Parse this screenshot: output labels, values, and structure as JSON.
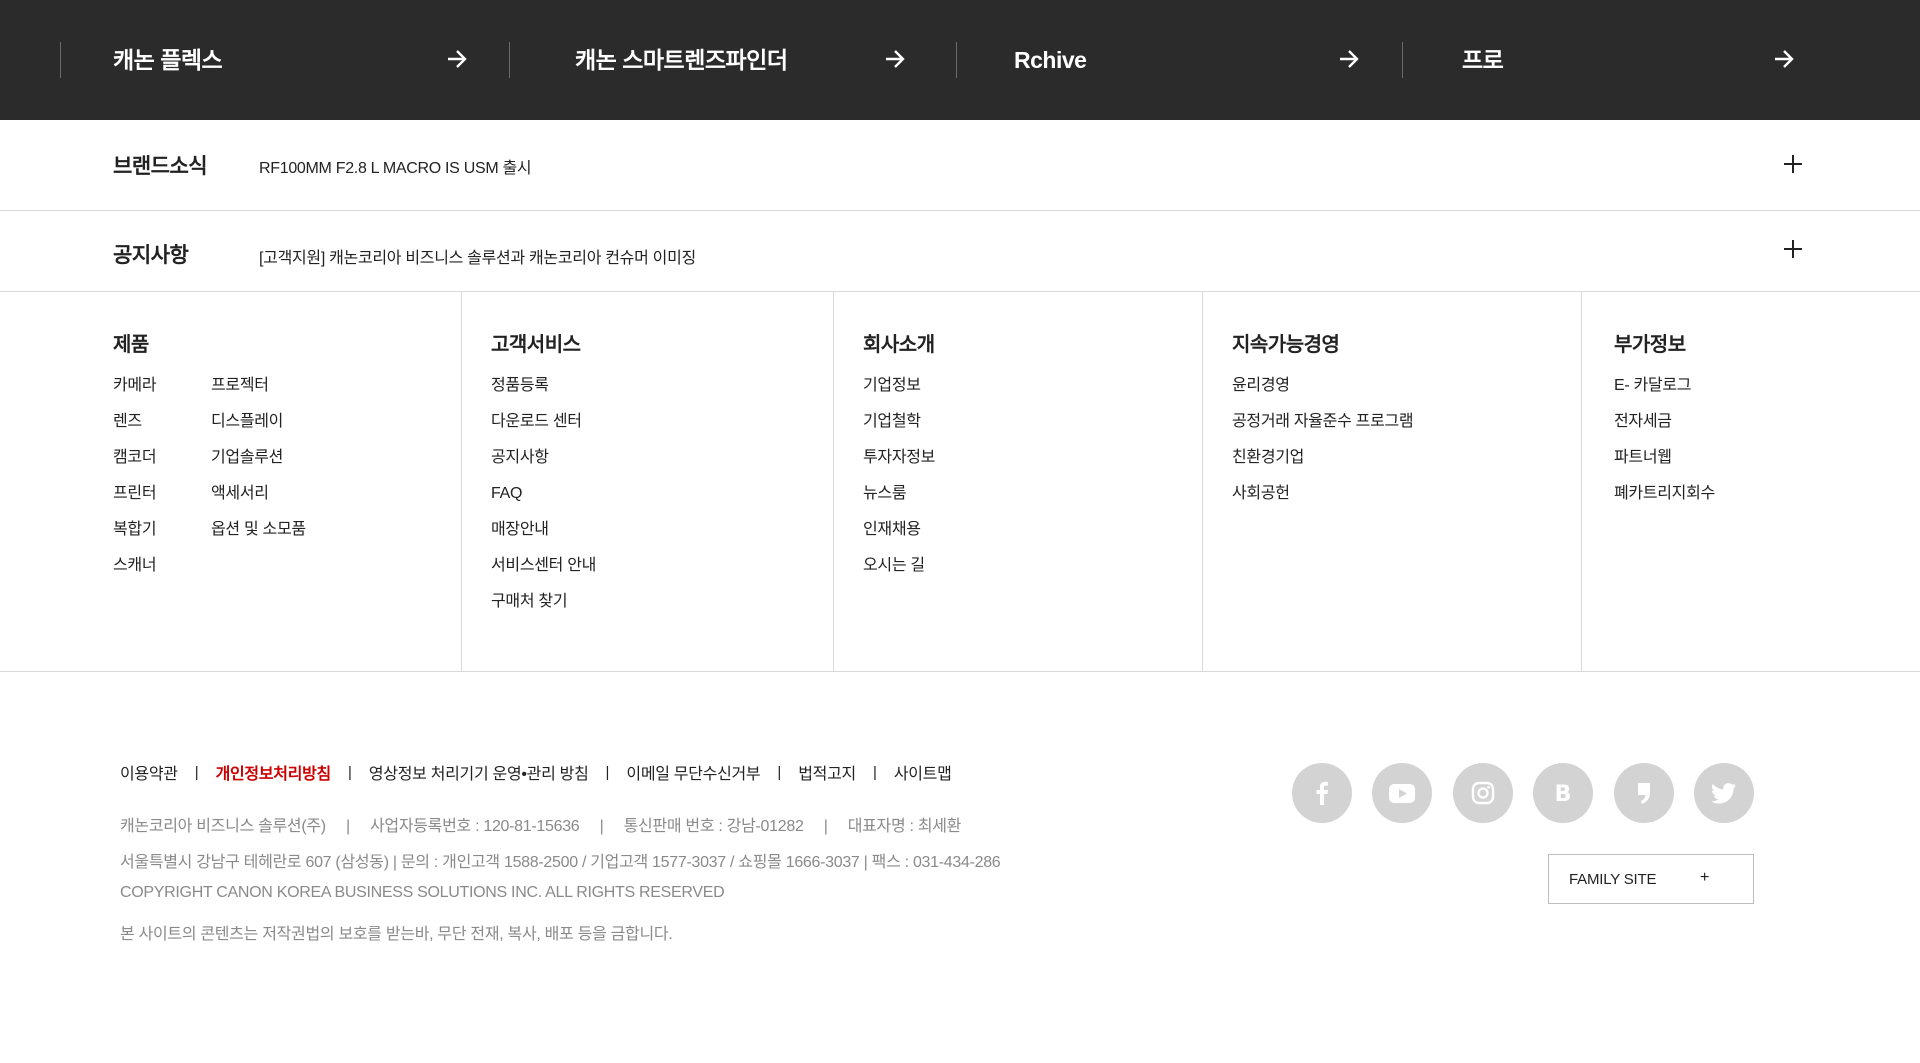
{
  "topbar": {
    "items": [
      {
        "label": "캐논 플렉스"
      },
      {
        "label": "캐논 스마트렌즈파인더"
      },
      {
        "label": "Rchive"
      },
      {
        "label": "프로"
      }
    ]
  },
  "news": {
    "brand": {
      "title": "브랜드소식",
      "text": "RF100MM F2.8 L MACRO IS USM 출시"
    },
    "notice": {
      "title": "공지사항",
      "text": "[고객지원] 캐논코리아 비즈니스 솔루션과 캐논코리아 컨슈머 이미징"
    }
  },
  "sitemap": {
    "products": {
      "title": "제품",
      "col1": [
        "카메라",
        "렌즈",
        "캠코더",
        "프린터",
        "복합기",
        "스캐너"
      ],
      "col2": [
        "프로젝터",
        "디스플레이",
        "기업솔루션",
        "액세서리",
        "옵션 및 소모품"
      ]
    },
    "support": {
      "title": "고객서비스",
      "items": [
        "정품등록",
        "다운로드 센터",
        "공지사항",
        "FAQ",
        "매장안내",
        "서비스센터 안내",
        "구매처 찾기"
      ]
    },
    "company": {
      "title": "회사소개",
      "items": [
        "기업정보",
        "기업철학",
        "투자자정보",
        "뉴스룸",
        "인재채용",
        "오시는 길"
      ]
    },
    "sustainability": {
      "title": "지속가능경영",
      "items": [
        "윤리경영",
        "공정거래 자율준수 프로그램",
        "친환경기업",
        "사회공헌"
      ]
    },
    "extra": {
      "title": "부가정보",
      "items": [
        "E- 카달로그",
        "전자세금",
        "파트너웹",
        "폐카트리지회수"
      ]
    }
  },
  "footer": {
    "links": [
      "이용약관",
      "개인정보처리방침",
      "영상정보 처리기기 운영•관리 방침",
      "이메일 무단수신거부",
      "법적고지",
      "사이트맵"
    ],
    "separator": "|",
    "info": {
      "company": "캐논코리아 비즈니스 솔루션(주)",
      "biz_no": "사업자등록번호 : 120-81-15636",
      "mail_order": "통신판매 번호 : 강남-01282",
      "ceo": "대표자명 : 최세환",
      "address": "서울특별시 강남구 테헤란로 607 (삼성동) | 문의 : 개인고객 1588-2500 / 기업고객 1577-3037 / 쇼핑몰 1666-3037 | 팩스 : 031-434-286",
      "copyright": "COPYRIGHT CANON KOREA BUSINESS SOLUTIONS INC. ALL RIGHTS RESERVED",
      "notice": "본 사이트의 콘텐츠는 저작권법의 보호를 받는바, 무단 전재, 복사, 배포 등을 금합니다."
    },
    "sns": [
      "facebook-icon",
      "youtube-icon",
      "instagram-icon",
      "blog-icon",
      "post-icon",
      "twitter-icon"
    ],
    "family_site": {
      "label": "FAMILY SITE",
      "icon": "+"
    }
  },
  "colors": {
    "topbar_bg": "#2b2b2b",
    "accent_red": "#cc0000",
    "sns_bg": "#d3d3d3",
    "muted_text": "#8a8a8a"
  }
}
